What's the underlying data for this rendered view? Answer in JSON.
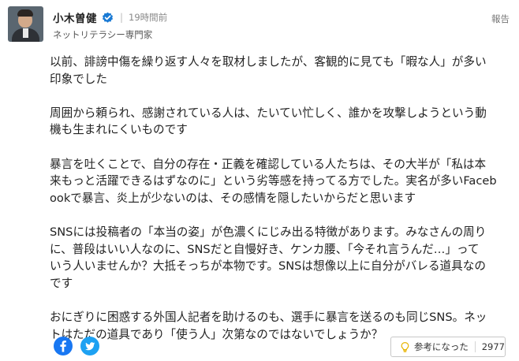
{
  "comment": {
    "author": {
      "name": "小木曽健",
      "title": "ネットリテラシー専門家",
      "verified": true
    },
    "timestamp": "19時間前",
    "separator": "|",
    "report_label": "報告",
    "paragraphs": [
      [
        "以前、誹謗中傷を繰り返す人々を取材しましたが、客観的に見ても「暇な人」が多い",
        "印象でした"
      ],
      [
        "周囲から頼られ、感謝されている人は、たいてい忙しく、誰かを攻撃しようという動",
        "機も生まれにくいものです"
      ],
      [
        "暴言を吐くことで、自分の存在・正義を確認している人たちは、その大半が「私は本",
        "来もっと活躍できるはずなのに」という劣等感を持ってる方でした。実名が多いFaceb",
        "ookで暴言、炎上が少ないのは、その感情を隠したいからだと思います"
      ],
      [
        "SNSには投稿者の「本当の姿」が色濃くにじみ出る特徴があります。みなさんの周り",
        "に、普段はいい人なのに、SNSだと自慢好き、ケンカ腰、「今それ言うんだ…」って",
        "いう人いませんか？大抵そっちが本物です。SNSは想像以上に自分がバレる道具なの",
        "です"
      ],
      [
        "おにぎりに困惑する外国人記者を助けるのも、選手に暴言を送るのも同じSNS。ネッ",
        "トはただの道具であり「使う人」次第なのではないでしょうか？"
      ]
    ],
    "helpful": {
      "label": "参考になった",
      "count": "2977"
    }
  },
  "share": {
    "facebook_icon": "facebook-icon",
    "twitter_icon": "twitter-icon"
  },
  "colors": {
    "facebook": "#1877f2",
    "twitter": "#1da1f2",
    "verified": "#1a7ad4",
    "bulb": "#e8b400"
  }
}
